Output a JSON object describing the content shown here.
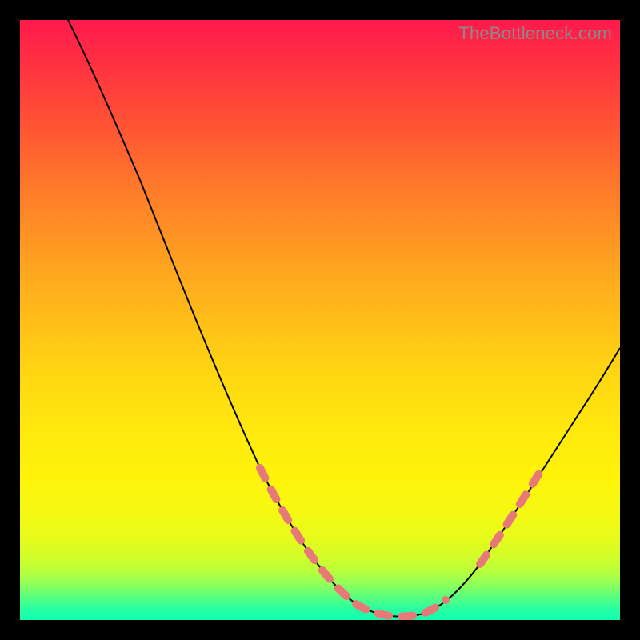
{
  "watermark": "TheBottleneck.com",
  "chart_data": {
    "type": "line",
    "title": "",
    "xlabel": "",
    "ylabel": "",
    "xlim": [
      0,
      100
    ],
    "ylim": [
      0,
      100
    ],
    "grid": false,
    "legend": false,
    "series": [
      {
        "name": "bottleneck-curve",
        "x": [
          8,
          12,
          18,
          24,
          30,
          36,
          42,
          48,
          52,
          56,
          60,
          64,
          68,
          72,
          78,
          85,
          92,
          100
        ],
        "y": [
          100,
          92,
          80,
          68,
          56,
          44,
          32,
          18,
          10,
          4,
          1,
          1,
          4,
          8,
          16,
          26,
          36,
          48
        ]
      }
    ],
    "highlight_segments": [
      {
        "name": "left-dash",
        "x_range": [
          41,
          56
        ],
        "style": "dashed"
      },
      {
        "name": "valley-dash",
        "x_range": [
          56,
          70
        ],
        "style": "dashed"
      },
      {
        "name": "right-dash",
        "x_range": [
          76,
          85
        ],
        "style": "dashed"
      }
    ],
    "gradient_stops": [
      {
        "pos": 0.0,
        "color": "#ff1a4d"
      },
      {
        "pos": 0.5,
        "color": "#ffd413"
      },
      {
        "pos": 0.85,
        "color": "#f5f912"
      },
      {
        "pos": 1.0,
        "color": "#10ffb0"
      }
    ]
  }
}
